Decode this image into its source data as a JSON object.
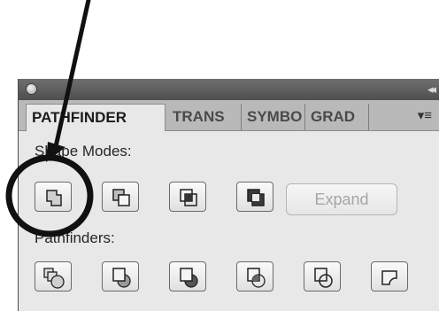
{
  "panel": {
    "tabs": [
      {
        "label": "PATHFINDER",
        "active": true
      },
      {
        "label": "TRANS",
        "active": false
      },
      {
        "label": "SYMBO",
        "active": false
      },
      {
        "label": "GRAD",
        "active": false
      }
    ],
    "menu_icon": "panel-menu-icon",
    "collapse_icon": "double-chevron-icon"
  },
  "shape_modes": {
    "label": "Shape Modes:",
    "buttons": [
      "unite-icon",
      "minus-front-icon",
      "intersect-icon",
      "exclude-icon"
    ],
    "expand_label": "Expand"
  },
  "pathfinders": {
    "label": "Pathfinders:",
    "buttons": [
      "divide-icon",
      "trim-icon",
      "merge-icon",
      "crop-icon",
      "outline-icon",
      "minus-back-icon"
    ]
  },
  "annotation": {
    "color": "#111111"
  }
}
